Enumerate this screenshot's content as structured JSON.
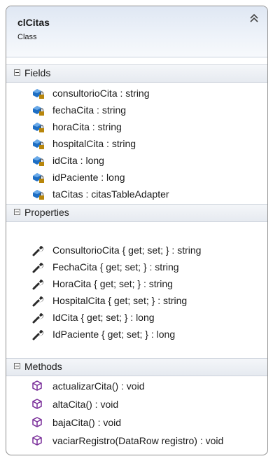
{
  "class": {
    "name": "clCitas",
    "kind": "Class"
  },
  "sections": {
    "fields": {
      "title": "Fields",
      "items": [
        "consultorioCita : string",
        "fechaCita : string",
        "horaCita : string",
        "hospitalCita : string",
        "idCita : long",
        "idPaciente : long",
        "taCitas : citasTableAdapter"
      ]
    },
    "properties": {
      "title": "Properties",
      "items": [
        "ConsultorioCita { get; set; } : string",
        "FechaCita { get; set; } : string",
        "HoraCita { get; set; } : string",
        "HospitalCita { get; set; } : string",
        "IdCita { get; set; } : long",
        "IdPaciente { get; set; } : long"
      ]
    },
    "methods": {
      "title": "Methods",
      "items": [
        "actualizarCita() : void",
        "altaCita() : void",
        "bajaCita() : void",
        "vaciarRegistro(DataRow registro) : void"
      ]
    }
  },
  "icons": {
    "field": "private-field-icon",
    "property": "property-wrench-icon",
    "method": "method-cube-icon",
    "collapse": "collapse-chevron-icon",
    "section_toggle": "minus-box-icon"
  },
  "colors": {
    "field_blue": "#1f6fc4",
    "lock_gold": "#b8860b",
    "method_purple": "#7a2f9a",
    "wrench_dark": "#2a2a2a"
  }
}
